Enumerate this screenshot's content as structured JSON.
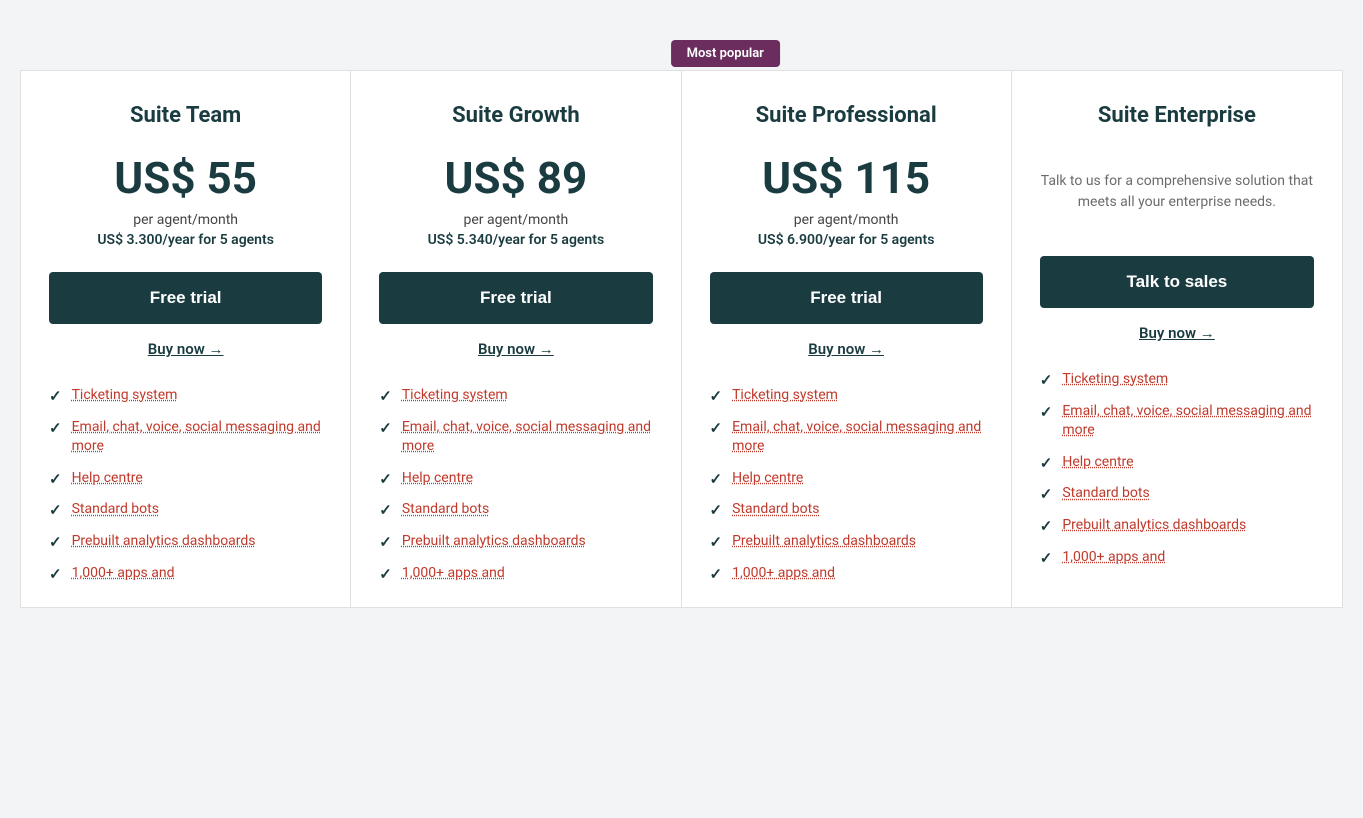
{
  "badge": {
    "label": "Most popular"
  },
  "plans": [
    {
      "id": "suite-team",
      "name": "Suite Team",
      "price": "US$ 55",
      "price_note": "per agent/month",
      "annual": "US$ 3.300/year for 5 agents",
      "annual_bold": "5 agents",
      "cta_label": "Free trial",
      "buy_now_label": "Buy now →",
      "features": [
        "Ticketing system",
        "Email, chat, voice, social messaging and more",
        "Help centre",
        "Standard bots",
        "Prebuilt analytics dashboards",
        "1,000+ apps and"
      ]
    },
    {
      "id": "suite-growth",
      "name": "Suite Growth",
      "price": "US$ 89",
      "price_note": "per agent/month",
      "annual": "US$ 5.340/year for 5 agents",
      "annual_bold": "5 agents",
      "cta_label": "Free trial",
      "buy_now_label": "Buy now →",
      "features": [
        "Ticketing system",
        "Email, chat, voice, social messaging and more",
        "Help centre",
        "Standard bots",
        "Prebuilt analytics dashboards",
        "1,000+ apps and"
      ]
    },
    {
      "id": "suite-professional",
      "name": "Suite Professional",
      "price": "US$ 115",
      "price_note": "per agent/month",
      "annual": "US$ 6.900/year for 5 agents",
      "annual_bold": "5 agents",
      "cta_label": "Free trial",
      "buy_now_label": "Buy now →",
      "features": [
        "Ticketing system",
        "Email, chat, voice, social messaging and more",
        "Help centre",
        "Standard bots",
        "Prebuilt analytics dashboards",
        "1,000+ apps and"
      ]
    },
    {
      "id": "suite-enterprise",
      "name": "Suite Enterprise",
      "price": null,
      "enterprise_desc": "Talk to us for a comprehensive solution that meets all your enterprise needs.",
      "cta_label": "Talk to sales",
      "buy_now_label": "Buy now →",
      "features": [
        "Ticketing system",
        "Email, chat, voice, social messaging and more",
        "Help centre",
        "Standard bots",
        "Prebuilt analytics dashboards",
        "1,000+ apps and"
      ]
    }
  ]
}
